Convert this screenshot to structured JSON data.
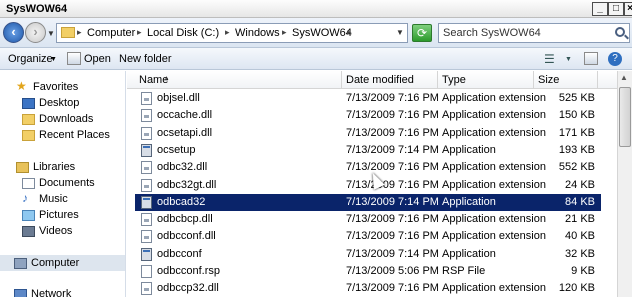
{
  "window": {
    "title": "SysWOW64"
  },
  "address": {
    "crumbs": [
      "Computer",
      "Local Disk (C:)",
      "Windows",
      "SysWOW64"
    ],
    "search_placeholder": "Search SysWOW64"
  },
  "toolbar": {
    "organize": "Organize",
    "open": "Open",
    "new_folder": "New folder"
  },
  "sidebar": {
    "favorites": "Favorites",
    "fav_items": [
      "Desktop",
      "Downloads",
      "Recent Places"
    ],
    "libraries": "Libraries",
    "lib_items": [
      "Documents",
      "Music",
      "Pictures",
      "Videos"
    ],
    "computer": "Computer",
    "network": "Network"
  },
  "columns": {
    "name": "Name",
    "date": "Date modified",
    "type": "Type",
    "size": "Size"
  },
  "files": [
    {
      "name": "objsel.dll",
      "date": "7/13/2009 7:16 PM",
      "type": "Application extension",
      "size": "525 KB",
      "kind": "dll"
    },
    {
      "name": "occache.dll",
      "date": "7/13/2009 7:16 PM",
      "type": "Application extension",
      "size": "150 KB",
      "kind": "dll"
    },
    {
      "name": "ocsetapi.dll",
      "date": "7/13/2009 7:16 PM",
      "type": "Application extension",
      "size": "171 KB",
      "kind": "dll"
    },
    {
      "name": "ocsetup",
      "date": "7/13/2009 7:14 PM",
      "type": "Application",
      "size": "193 KB",
      "kind": "app"
    },
    {
      "name": "odbc32.dll",
      "date": "7/13/2009 7:16 PM",
      "type": "Application extension",
      "size": "552 KB",
      "kind": "dll"
    },
    {
      "name": "odbc32gt.dll",
      "date": "7/13/2009 7:16 PM",
      "type": "Application extension",
      "size": "24 KB",
      "kind": "dll"
    },
    {
      "name": "odbcad32",
      "date": "7/13/2009 7:14 PM",
      "type": "Application",
      "size": "84 KB",
      "kind": "app",
      "selected": true
    },
    {
      "name": "odbcbcp.dll",
      "date": "7/13/2009 7:16 PM",
      "type": "Application extension",
      "size": "21 KB",
      "kind": "dll"
    },
    {
      "name": "odbcconf.dll",
      "date": "7/13/2009 7:16 PM",
      "type": "Application extension",
      "size": "40 KB",
      "kind": "dll"
    },
    {
      "name": "odbcconf",
      "date": "7/13/2009 7:14 PM",
      "type": "Application",
      "size": "32 KB",
      "kind": "app"
    },
    {
      "name": "odbcconf.rsp",
      "date": "7/13/2009 5:06 PM",
      "type": "RSP File",
      "size": "9 KB",
      "kind": "file"
    },
    {
      "name": "odbccp32.dll",
      "date": "7/13/2009 7:16 PM",
      "type": "Application extension",
      "size": "120 KB",
      "kind": "dll"
    }
  ],
  "colors": {
    "selection": "#0a246a",
    "accent": "#1d56a8"
  }
}
